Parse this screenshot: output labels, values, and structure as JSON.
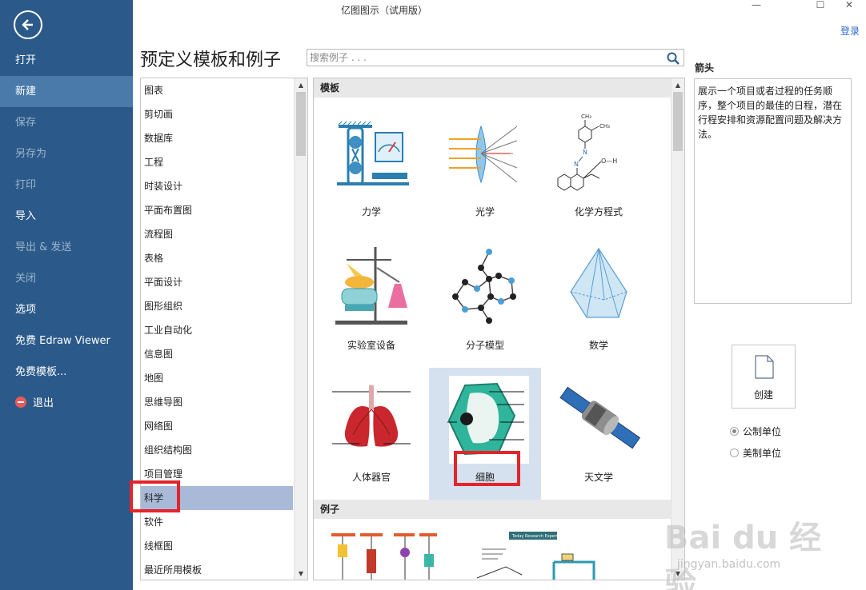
{
  "window": {
    "title": "亿图图示（试用版）",
    "minimize": "—",
    "maximize": "☐",
    "close": "✕"
  },
  "login_label": "登录",
  "sidebar": {
    "items": [
      {
        "label": "打开",
        "state": "normal"
      },
      {
        "label": "新建",
        "state": "active"
      },
      {
        "label": "保存",
        "state": "dim"
      },
      {
        "label": "另存为",
        "state": "dim"
      },
      {
        "label": "打印",
        "state": "dim"
      },
      {
        "label": "导入",
        "state": "normal"
      },
      {
        "label": "导出 & 发送",
        "state": "dim"
      },
      {
        "label": "关闭",
        "state": "dim"
      },
      {
        "label": "选项",
        "state": "normal"
      },
      {
        "label": "免费 Edraw Viewer",
        "state": "normal"
      },
      {
        "label": "免费模板...",
        "state": "normal"
      },
      {
        "label": "退出",
        "state": "normal"
      }
    ]
  },
  "page_title": "预定义模板和例子",
  "search": {
    "placeholder": "搜索例子 . . ."
  },
  "categories": [
    "图表",
    "剪切画",
    "数据库",
    "工程",
    "时装设计",
    "平面布置图",
    "流程图",
    "表格",
    "平面设计",
    "图形组织",
    "工业自动化",
    "信息图",
    "地图",
    "思维导图",
    "网络图",
    "组织结构图",
    "项目管理",
    "科学",
    "软件",
    "线框图",
    "最近所用模板"
  ],
  "selected_category": "科学",
  "templates_header": "模板",
  "templates": [
    {
      "label": "力学",
      "icon": "mechanics-icon"
    },
    {
      "label": "光学",
      "icon": "optics-icon"
    },
    {
      "label": "化学方程式",
      "icon": "chemical-formula-icon"
    },
    {
      "label": "实验室设备",
      "icon": "lab-equipment-icon"
    },
    {
      "label": "分子模型",
      "icon": "molecule-icon"
    },
    {
      "label": "数学",
      "icon": "pyramid-icon"
    },
    {
      "label": "人体器官",
      "icon": "lungs-icon"
    },
    {
      "label": "细胞",
      "icon": "cell-icon"
    },
    {
      "label": "天文学",
      "icon": "satellite-icon"
    }
  ],
  "selected_template": "细胞",
  "examples_header": "例子",
  "chem_labels": {
    "ch3_top": "CH₃",
    "ch3_right": "CH₃",
    "n1": "N",
    "n2": "N",
    "oh": "O—H"
  },
  "example_banner_text": "Today Research Experiment",
  "right": {
    "title": "箭头",
    "description": "展示一个项目或者过程的任务顺序，整个项目的最佳的日程，潜在行程安排和资源配置问题及解决方法。",
    "create_label": "创建",
    "units": [
      {
        "label": "公制单位",
        "checked": true
      },
      {
        "label": "美制单位",
        "checked": false
      }
    ]
  },
  "watermark": {
    "brand": "Bai du 经验",
    "url": "jingyan.baidu.com"
  },
  "colors": {
    "sidebar_bg": "#2b5a8a",
    "sidebar_active": "#4a7aa9",
    "highlight_red": "#e3242b",
    "selected_category": "#a9b9d8",
    "selected_tile": "#d5e1ee"
  }
}
